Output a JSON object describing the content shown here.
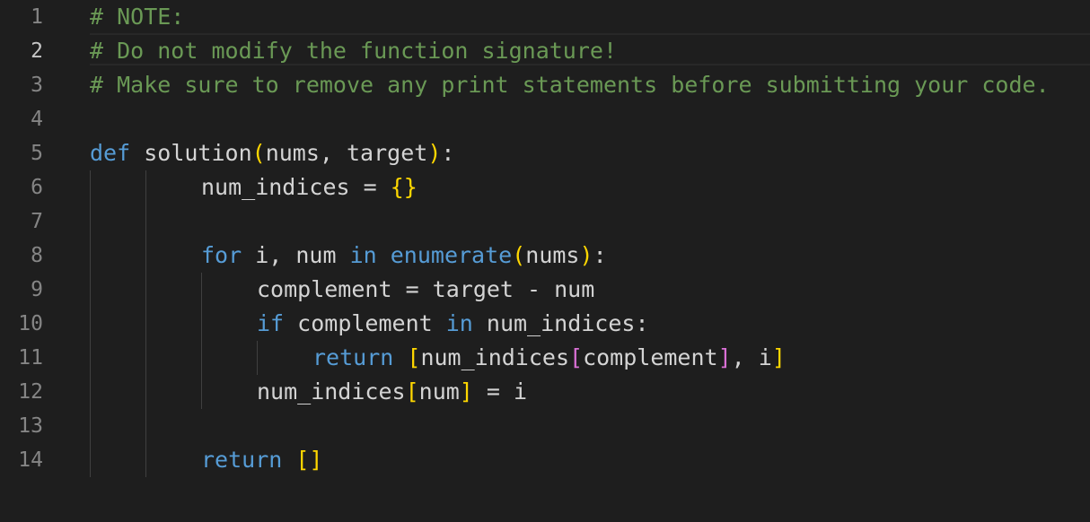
{
  "editor": {
    "line_numbers": [
      "1",
      "2",
      "3",
      "4",
      "5",
      "6",
      "7",
      "8",
      "9",
      "10",
      "11",
      "12",
      "13",
      "14"
    ],
    "active_line": "2",
    "lines": {
      "l1": {
        "comment": "# NOTE:"
      },
      "l2": {
        "comment": "# Do not modify the function signature!"
      },
      "l3": {
        "comment": "# Make sure to remove any print statements before submitting your code."
      },
      "l5": {
        "kw": "def",
        "name": "solution",
        "open": "(",
        "params": "nums, target",
        "close": ")",
        "colon": ":"
      },
      "l6": {
        "var": "num_indices",
        "op": " = ",
        "open": "{",
        "close": "}"
      },
      "l8": {
        "kw": "for",
        "vars": " i, num ",
        "kw2": "in",
        "builtin": "enumerate",
        "open": "(",
        "arg": "nums",
        "close": ")",
        "colon": ":"
      },
      "l9": {
        "text": "complement = target - num"
      },
      "l10": {
        "kw": "if",
        "mid": " complement ",
        "kw2": "in",
        "tail": " num_indices:"
      },
      "l11": {
        "kw": "return",
        "open": "[",
        "a": "num_indices",
        "open2": "[",
        "b": "complement",
        "close2": "]",
        "c": ", i",
        "close": "]"
      },
      "l12": {
        "a": "num_indices",
        "open": "[",
        "b": "num",
        "close": "]",
        "c": " = i"
      },
      "l14": {
        "kw": "return",
        "brackets": "[]"
      }
    }
  },
  "colors": {
    "background": "#1e1e1e",
    "comment": "#6a9955",
    "keyword": "#569cd6",
    "bracket_level1": "#ffd700",
    "bracket_level2": "#da70d6",
    "line_number": "#858585"
  }
}
